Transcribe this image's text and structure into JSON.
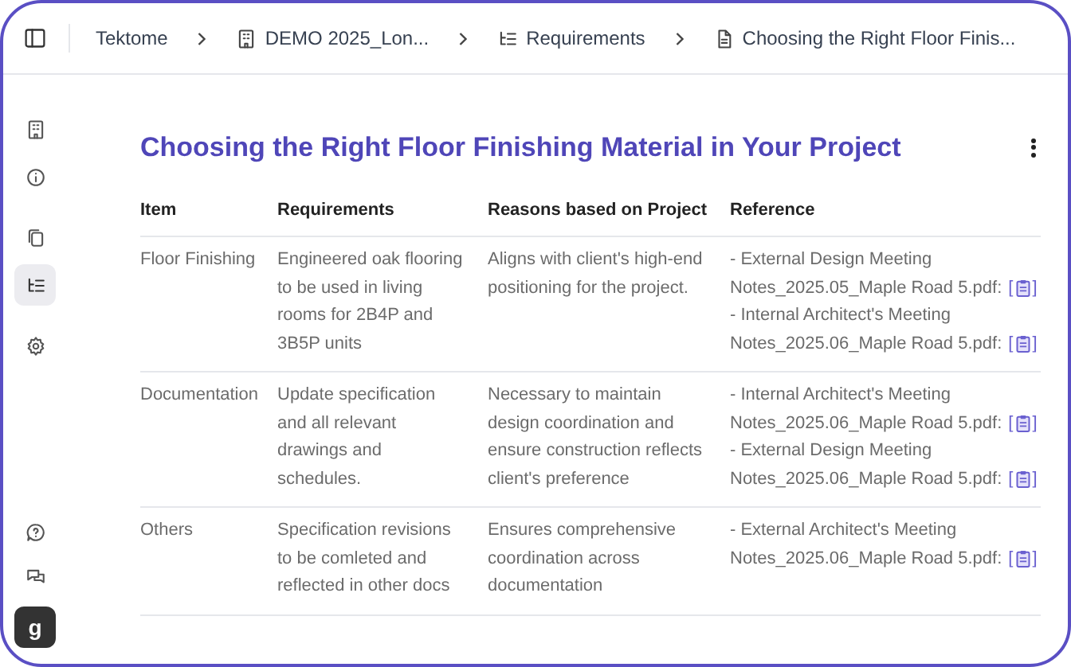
{
  "breadcrumb": [
    {
      "kind": "text",
      "label": "Tektome"
    },
    {
      "kind": "building",
      "label": "DEMO 2025_Lon..."
    },
    {
      "kind": "list",
      "label": "Requirements"
    },
    {
      "kind": "doc",
      "label": "Choosing the Right Floor Finis..."
    }
  ],
  "sidebar": {
    "items": [
      {
        "kind": "building",
        "selected": false
      },
      {
        "kind": "info",
        "selected": false
      },
      {
        "kind": "copy",
        "selected": false
      },
      {
        "kind": "list",
        "selected": true
      },
      {
        "kind": "gear",
        "selected": false
      }
    ],
    "bottom": [
      {
        "kind": "help"
      },
      {
        "kind": "chat"
      }
    ],
    "avatar": "g"
  },
  "title": "Choosing the Right Floor Finishing Material in Your Project",
  "table": {
    "columns": [
      "Item",
      "Requirements",
      "Reasons based on Project",
      "Reference"
    ],
    "rows": [
      {
        "item": "Floor Finishing",
        "requirements": "Engineered oak flooring to be used in living rooms for 2B4P and 3B5P units",
        "reasons": "Aligns with client's high-end positioning for the project.",
        "references": [
          {
            "line1": "- External Design Meeting",
            "line2": "Notes_2025.05_Maple Road 5.pdf:",
            "open": "[",
            "close": "]"
          },
          {
            "line1": "- Internal Architect's Meeting",
            "line2": "Notes_2025.06_Maple Road 5.pdf:",
            "open": "[",
            "close": "]"
          }
        ]
      },
      {
        "item": "Documentation",
        "requirements": "Update specification and all relevant drawings and schedules.",
        "reasons": "Necessary to maintain design coordination and ensure construction reflects client's preference",
        "references": [
          {
            "line1": "- Internal Architect's Meeting",
            "line2": "Notes_2025.06_Maple Road 5.pdf:",
            "open": "[",
            "close": "]"
          },
          {
            "line1": "- External Design Meeting",
            "line2": "Notes_2025.06_Maple Road 5.pdf:",
            "open": "[",
            "close": "]"
          }
        ]
      },
      {
        "item": "Others",
        "requirements": "Specification revisions to be comleted and reflected in other docs",
        "reasons": "Ensures comprehensive coordination across documentation",
        "references": [
          {
            "line1": "- External Architect's Meeting",
            "line2": "Notes_2025.06_Maple Road 5.pdf:",
            "open": "[",
            "close": "]"
          }
        ]
      }
    ]
  }
}
